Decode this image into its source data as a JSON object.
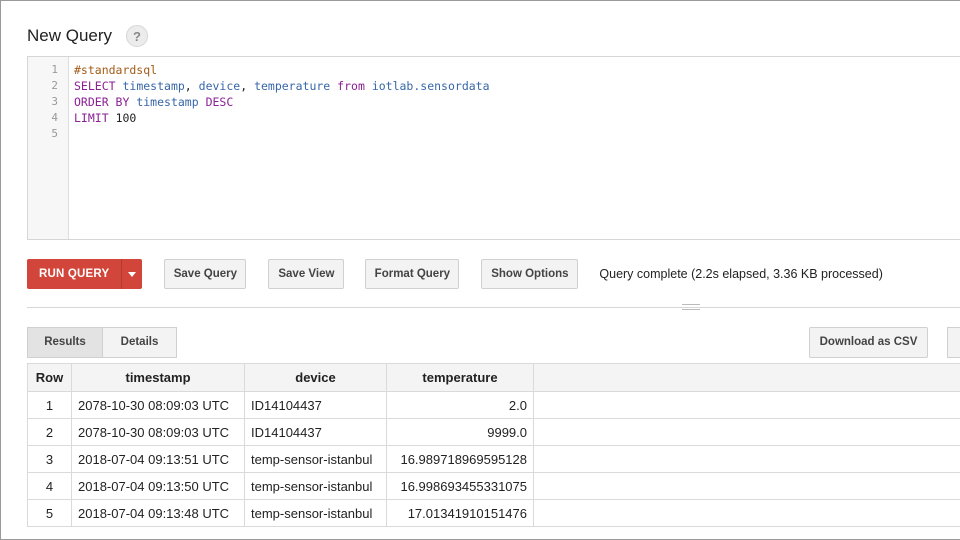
{
  "header": {
    "title": "New Query",
    "help_icon": "?"
  },
  "editor": {
    "line_numbers": [
      "1",
      "2",
      "3",
      "4",
      "5"
    ],
    "lines": [
      [
        {
          "t": "#standardsql",
          "k": "comment"
        }
      ],
      [
        {
          "t": "SELECT",
          "k": "kw"
        },
        {
          "t": " ",
          "k": "plain"
        },
        {
          "t": "timestamp",
          "k": "ident"
        },
        {
          "t": ", ",
          "k": "plain"
        },
        {
          "t": "device",
          "k": "ident"
        },
        {
          "t": ", ",
          "k": "plain"
        },
        {
          "t": "temperature",
          "k": "ident"
        },
        {
          "t": " ",
          "k": "plain"
        },
        {
          "t": "from",
          "k": "kw"
        },
        {
          "t": " ",
          "k": "plain"
        },
        {
          "t": "iotlab.sensordata",
          "k": "ident"
        }
      ],
      [
        {
          "t": "ORDER BY",
          "k": "kw"
        },
        {
          "t": " ",
          "k": "plain"
        },
        {
          "t": "timestamp",
          "k": "ident"
        },
        {
          "t": " ",
          "k": "plain"
        },
        {
          "t": "DESC",
          "k": "kw"
        }
      ],
      [
        {
          "t": "LIMIT",
          "k": "kw"
        },
        {
          "t": " ",
          "k": "plain"
        },
        {
          "t": "100",
          "k": "num"
        }
      ],
      []
    ]
  },
  "toolbar": {
    "run_label": "RUN QUERY",
    "save_query_label": "Save Query",
    "save_view_label": "Save View",
    "format_query_label": "Format Query",
    "show_options_label": "Show Options",
    "status": "Query complete (2.2s elapsed, 3.36 KB processed)"
  },
  "tabs": {
    "results_label": "Results",
    "details_label": "Details",
    "download_label": "Download as CSV"
  },
  "table": {
    "columns": [
      "Row",
      "timestamp",
      "device",
      "temperature"
    ],
    "rows": [
      [
        "1",
        "2078-10-30 08:09:03 UTC",
        "ID14104437",
        "2.0"
      ],
      [
        "2",
        "2078-10-30 08:09:03 UTC",
        "ID14104437",
        "9999.0"
      ],
      [
        "3",
        "2018-07-04 09:13:51 UTC",
        "temp-sensor-istanbul",
        "16.989718969595128"
      ],
      [
        "4",
        "2018-07-04 09:13:50 UTC",
        "temp-sensor-istanbul",
        "16.998693455331075"
      ],
      [
        "5",
        "2018-07-04 09:13:48 UTC",
        "temp-sensor-istanbul",
        "17.01341910151476"
      ]
    ]
  },
  "colors": {
    "run_button": "#d2453a",
    "keyword": "#8b1f95",
    "identifier": "#3767a8",
    "comment": "#a35b17"
  }
}
